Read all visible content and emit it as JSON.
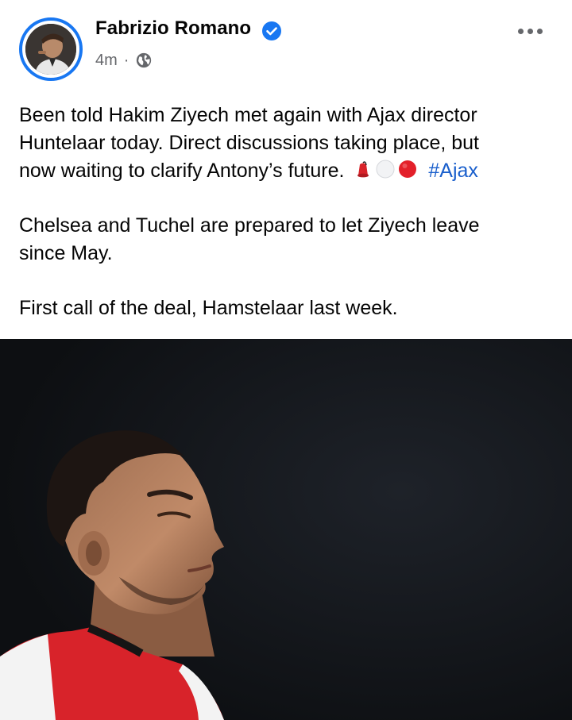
{
  "post": {
    "author": "Fabrizio Romano",
    "timestamp": "4m",
    "separator": "·",
    "verified": true,
    "privacy_icon": "globe-icon",
    "more_icon": "more-dots-icon",
    "paragraphs": [
      {
        "lines": [
          "Been told Hakim Ziyech met again with Ajax director",
          "Huntelaar today. Direct discussions taking place, but",
          "now waiting to clarify Antony’s future."
        ],
        "emojis": [
          "fez-hat-emoji",
          "white-circle-emoji",
          "red-circle-emoji"
        ],
        "hashtag": "#Ajax"
      },
      {
        "lines": [
          "Chelsea and Tuchel are prepared to let Ziyech leave",
          "since May."
        ]
      },
      {
        "lines": [
          "First call of the deal, Hamstelaar last week."
        ]
      }
    ],
    "image": {
      "alt_semantic": "player-photo",
      "jersey_colors": [
        "#d8232a",
        "#ffffff"
      ]
    }
  },
  "colors": {
    "accent": "#1877f2",
    "hashtag": "#1a5fcc",
    "meta_text": "#65676b",
    "image_background": "#121418"
  }
}
